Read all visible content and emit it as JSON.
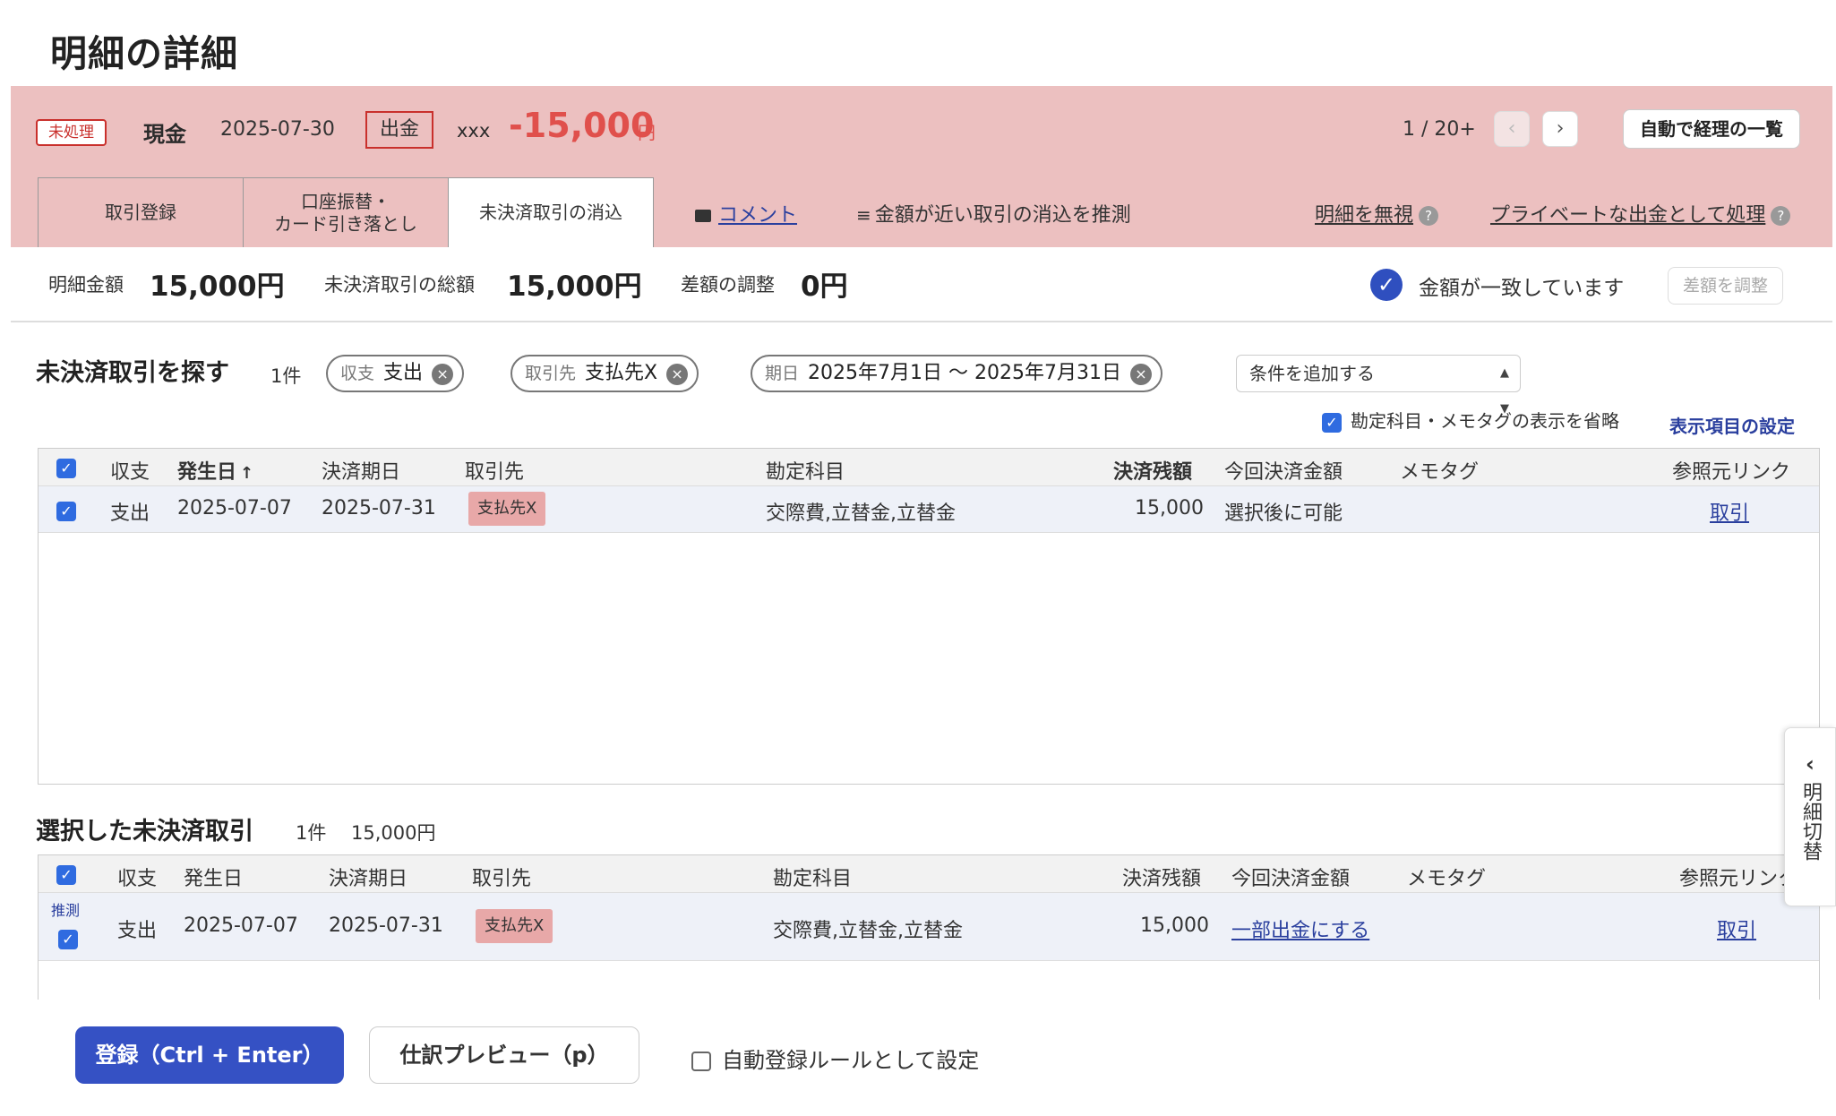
{
  "page": {
    "title": "明細の詳細"
  },
  "header": {
    "status_badge": "未処理",
    "account": "現金",
    "date": "2025-07-30",
    "direction": "出金",
    "description": "xxx",
    "amount": "-15,000",
    "currency": "円",
    "pager": "1 / 20+",
    "prev_icon": "‹",
    "next_icon": "›",
    "auto_list_button": "自動で経理の一覧",
    "tabs": [
      {
        "label": "取引登録"
      },
      {
        "label_line1": "口座振替・",
        "label_line2": "カード引き落とし"
      },
      {
        "label": "未決済取引の消込"
      }
    ],
    "comment_link": "コメント",
    "guess_link": "金額が近い取引の消込を推測",
    "ignore_link": "明細を無視",
    "private_link": "プライベートな出金として処理",
    "help_icon": "?"
  },
  "summary": {
    "statement_amount_label": "明細金額",
    "statement_amount": "15,000円",
    "unsettled_total_label": "未決済取引の総額",
    "unsettled_total": "15,000円",
    "diff_label": "差額の調整",
    "diff_value": "0円",
    "match_text": "金額が一致しています",
    "adjust_button": "差額を調整",
    "colors": {
      "accent": "#3551c4",
      "header_bg": "#ecc0c0",
      "amount": "#e0504c"
    }
  },
  "search": {
    "title": "未決済取引を探す",
    "count": "1件",
    "chips": [
      {
        "key": "収支",
        "value": "支出"
      },
      {
        "key": "取引先",
        "value": "支払先X"
      },
      {
        "key": "期日",
        "value": "2025年7月1日 〜 2025年7月31日"
      }
    ],
    "add_condition": "条件を追加する",
    "omit_label": "勘定科目・メモタグの表示を省略",
    "column_settings": "表示項目の設定",
    "table": {
      "headers": [
        "収支",
        "発生日",
        "決済期日",
        "取引先",
        "勘定科目",
        "決済残額",
        "今回決済金額",
        "メモタグ",
        "参照元リンク"
      ],
      "sort_arrow": "↑",
      "rows": [
        {
          "type": "支出",
          "date": "2025-07-07",
          "due": "2025-07-31",
          "partner": "支払先X",
          "account": "交際費,立替金,立替金",
          "balance": "15,000",
          "this_amount": "選択後に可能",
          "memo": "",
          "ref": "取引"
        }
      ]
    }
  },
  "selected": {
    "title": "選択した未決済取引",
    "count": "1件",
    "total": "15,000円",
    "table": {
      "headers": [
        "収支",
        "発生日",
        "決済期日",
        "取引先",
        "勘定科目",
        "決済残額",
        "今回決済金額",
        "メモタグ",
        "参照元リンク"
      ],
      "rows": [
        {
          "guess": "推測",
          "type": "支出",
          "date": "2025-07-07",
          "due": "2025-07-31",
          "partner": "支払先X",
          "account": "交際費,立替金,立替金",
          "balance": "15,000",
          "this_amount": "一部出金にする",
          "memo": "",
          "ref": "取引"
        }
      ]
    }
  },
  "footer": {
    "register_button": "登録（Ctrl + Enter）",
    "preview_button": "仕訳プレビュー（p）",
    "auto_rule_label": "自動登録ルールとして設定"
  },
  "side_toggle": {
    "chevron": "‹",
    "label": "明細切替"
  },
  "icons": {
    "check": "✓",
    "close": "×",
    "comment": "comment-icon",
    "list": "list-check-icon"
  }
}
